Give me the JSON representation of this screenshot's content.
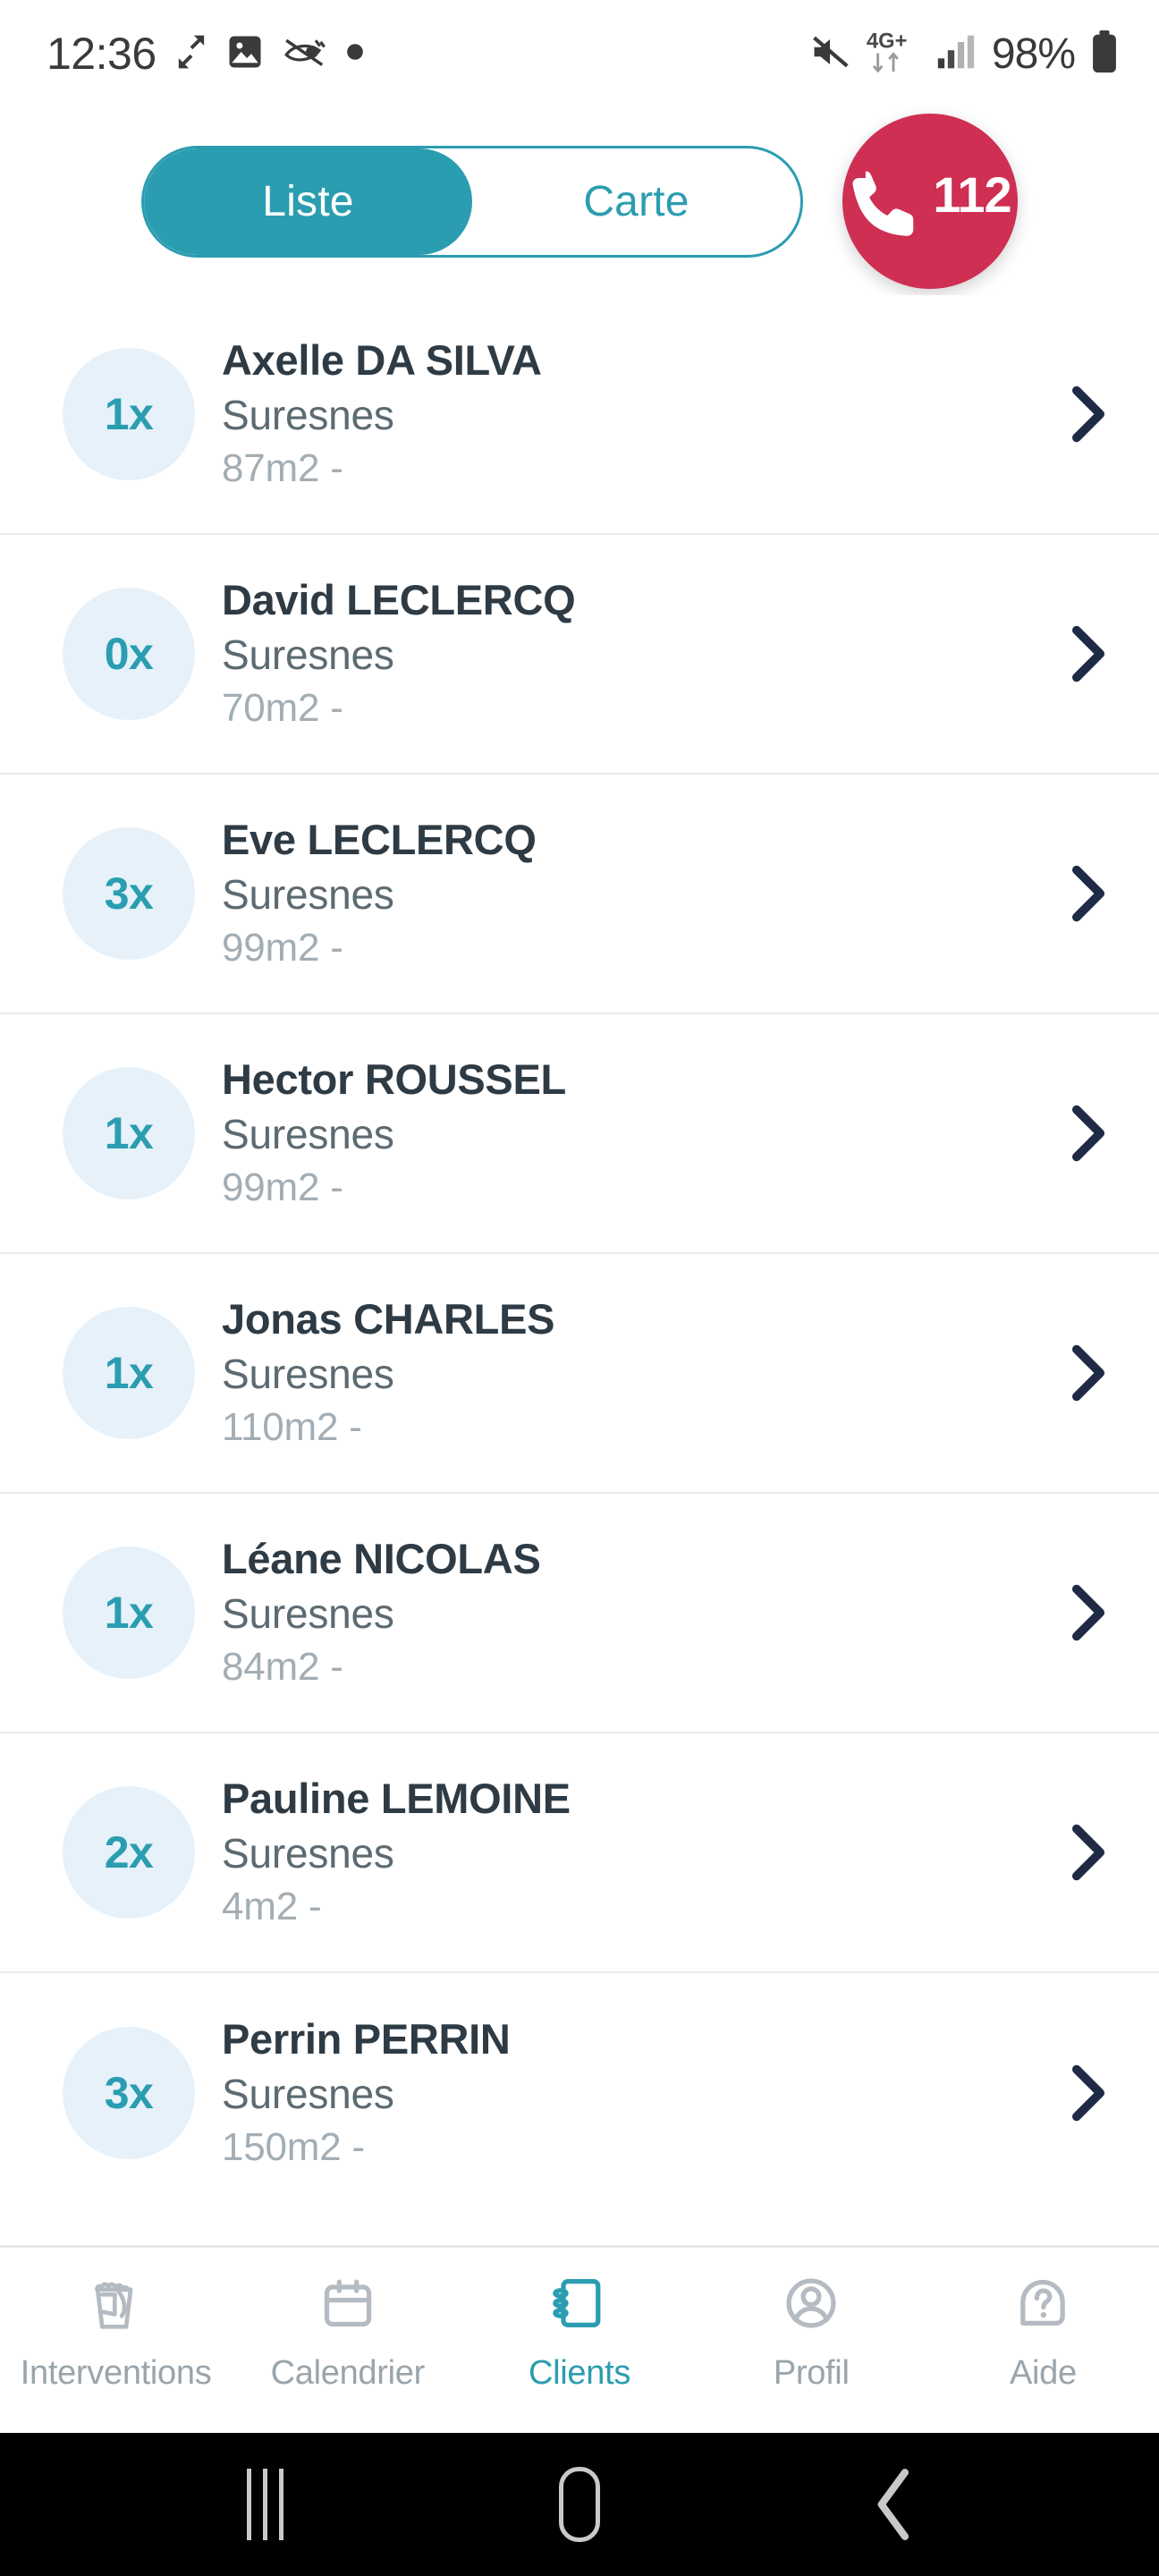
{
  "status_bar": {
    "time": "12:36",
    "battery_percent": "98%",
    "network": "4G+",
    "left_icons": [
      "expand-arrows-icon",
      "image-icon",
      "eye-slash-icon",
      "dot-icon"
    ],
    "right_icons": [
      "mute-icon",
      "network-4gplus-icon",
      "signal-bars-icon",
      "battery-icon"
    ]
  },
  "header": {
    "segments": [
      {
        "label": "Liste",
        "active": true
      },
      {
        "label": "Carte",
        "active": false
      }
    ],
    "emergency": {
      "number": "112",
      "icon": "phone-icon"
    }
  },
  "colors": {
    "teal": "#2b9db0",
    "emergency_red": "#cf2f52",
    "badge_bg": "#e6f1fa",
    "name_text": "#2e3b45",
    "city_text": "#5c6a72",
    "meta_text": "#a3adb4",
    "nav_inactive": "#9aa4ab",
    "divider": "#e9ecee"
  },
  "clients": [
    {
      "count": "1x",
      "name": "Axelle DA SILVA",
      "city": "Suresnes",
      "meta": "87m2 -"
    },
    {
      "count": "0x",
      "name": "David LECLERCQ",
      "city": "Suresnes",
      "meta": "70m2 -"
    },
    {
      "count": "3x",
      "name": "Eve LECLERCQ",
      "city": "Suresnes",
      "meta": "99m2 -"
    },
    {
      "count": "1x",
      "name": "Hector ROUSSEL",
      "city": "Suresnes",
      "meta": "99m2 -"
    },
    {
      "count": "1x",
      "name": "Jonas CHARLES",
      "city": "Suresnes",
      "meta": "110m2 -"
    },
    {
      "count": "1x",
      "name": "Léane NICOLAS",
      "city": "Suresnes",
      "meta": "84m2 -"
    },
    {
      "count": "2x",
      "name": "Pauline LEMOINE",
      "city": "Suresnes",
      "meta": "4m2 -"
    },
    {
      "count": "3x",
      "name": "Perrin PERRIN",
      "city": "Suresnes",
      "meta": "150m2 -"
    }
  ],
  "bottom_nav": [
    {
      "label": "Interventions",
      "icon": "cleaning-bucket-icon",
      "active": false
    },
    {
      "label": "Calendrier",
      "icon": "calendar-icon",
      "active": false
    },
    {
      "label": "Clients",
      "icon": "address-book-icon",
      "active": true
    },
    {
      "label": "Profil",
      "icon": "user-circle-icon",
      "active": false
    },
    {
      "label": "Aide",
      "icon": "help-question-icon",
      "active": false
    }
  ],
  "android_nav": {
    "recents": "recents-icon",
    "home": "home-icon",
    "back": "back-icon"
  }
}
